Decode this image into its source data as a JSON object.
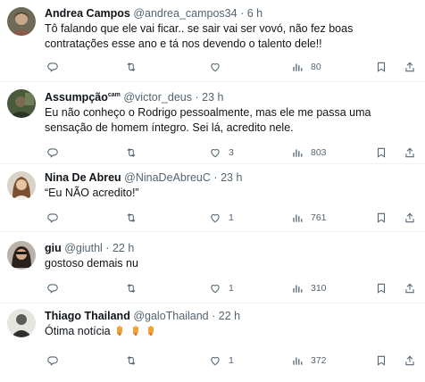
{
  "tweets": [
    {
      "name": "Andrea Campos",
      "name_sup": "",
      "handle": "@andrea_campos34",
      "time": "6 h",
      "text": "Tô falando que ele vai ficar.. se sair vai ser vovó, não fez boas contratações esse ano e tá nos devendo o talento dele!!",
      "replies": "",
      "retweets": "",
      "likes": "",
      "views": "80"
    },
    {
      "name": "Assumpção",
      "name_sup": "cam",
      "handle": "@victor_deus",
      "time": "23 h",
      "text": "Eu não conheço o Rodrigo pessoalmente, mas ele me passa uma sensação de homem íntegro. Sei lá, acredito nele.",
      "replies": "",
      "retweets": "",
      "likes": "3",
      "views": "803"
    },
    {
      "name": "Nina De Abreu",
      "name_sup": "",
      "handle": "@NinaDeAbreuC",
      "time": "23 h",
      "text": "“Eu NÃO acredito!”",
      "replies": "",
      "retweets": "",
      "likes": "1",
      "views": "761"
    },
    {
      "name": "giu",
      "name_sup": "",
      "handle": "@giuthl",
      "time": "22 h",
      "text": "gostoso demais nu",
      "replies": "",
      "retweets": "",
      "likes": "1",
      "views": "310"
    },
    {
      "name": "Thiago Thailand",
      "name_sup": "",
      "handle": "@galoThailand",
      "time": "22 h",
      "text": "Ótima notícia",
      "replies": "",
      "retweets": "",
      "likes": "1",
      "views": "372"
    }
  ],
  "ui": {
    "separator": "·",
    "more_glyph": "···"
  },
  "colors": {
    "text": "#0f1419",
    "muted": "#536471",
    "divider": "#eff3f4"
  },
  "icons": [
    "reply-icon",
    "retweet-icon",
    "like-icon",
    "views-icon",
    "bookmark-icon",
    "share-icon",
    "more-icon",
    "raised-hand-emoji"
  ]
}
